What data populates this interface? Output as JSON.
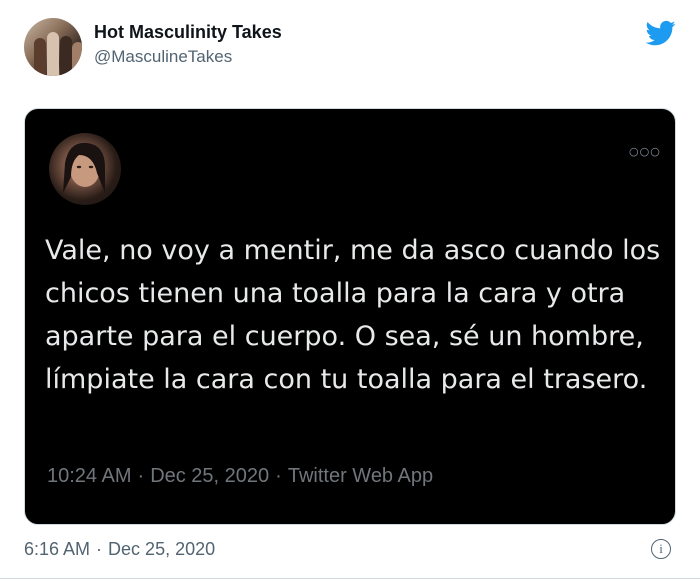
{
  "tweet": {
    "author_name": "Hot Masculinity Takes",
    "author_handle": "@MasculineTakes",
    "icon": "twitter-bird-icon",
    "brand_color": "#1d9bf0",
    "time": "6:16 AM",
    "date": "Dec 25, 2020",
    "info_icon": "info-icon"
  },
  "quoted": {
    "text": "Vale, no voy a mentir, me da asco cuando los chicos tienen una toalla para la cara y otra aparte para el cuerpo. O sea, sé un hombre, límpiate la cara con tu toalla para el trasero.",
    "time": "10:24 AM",
    "date": "Dec 25, 2020",
    "source": "Twitter Web App",
    "more_icon": "more-dots-icon",
    "background": "#000000"
  }
}
